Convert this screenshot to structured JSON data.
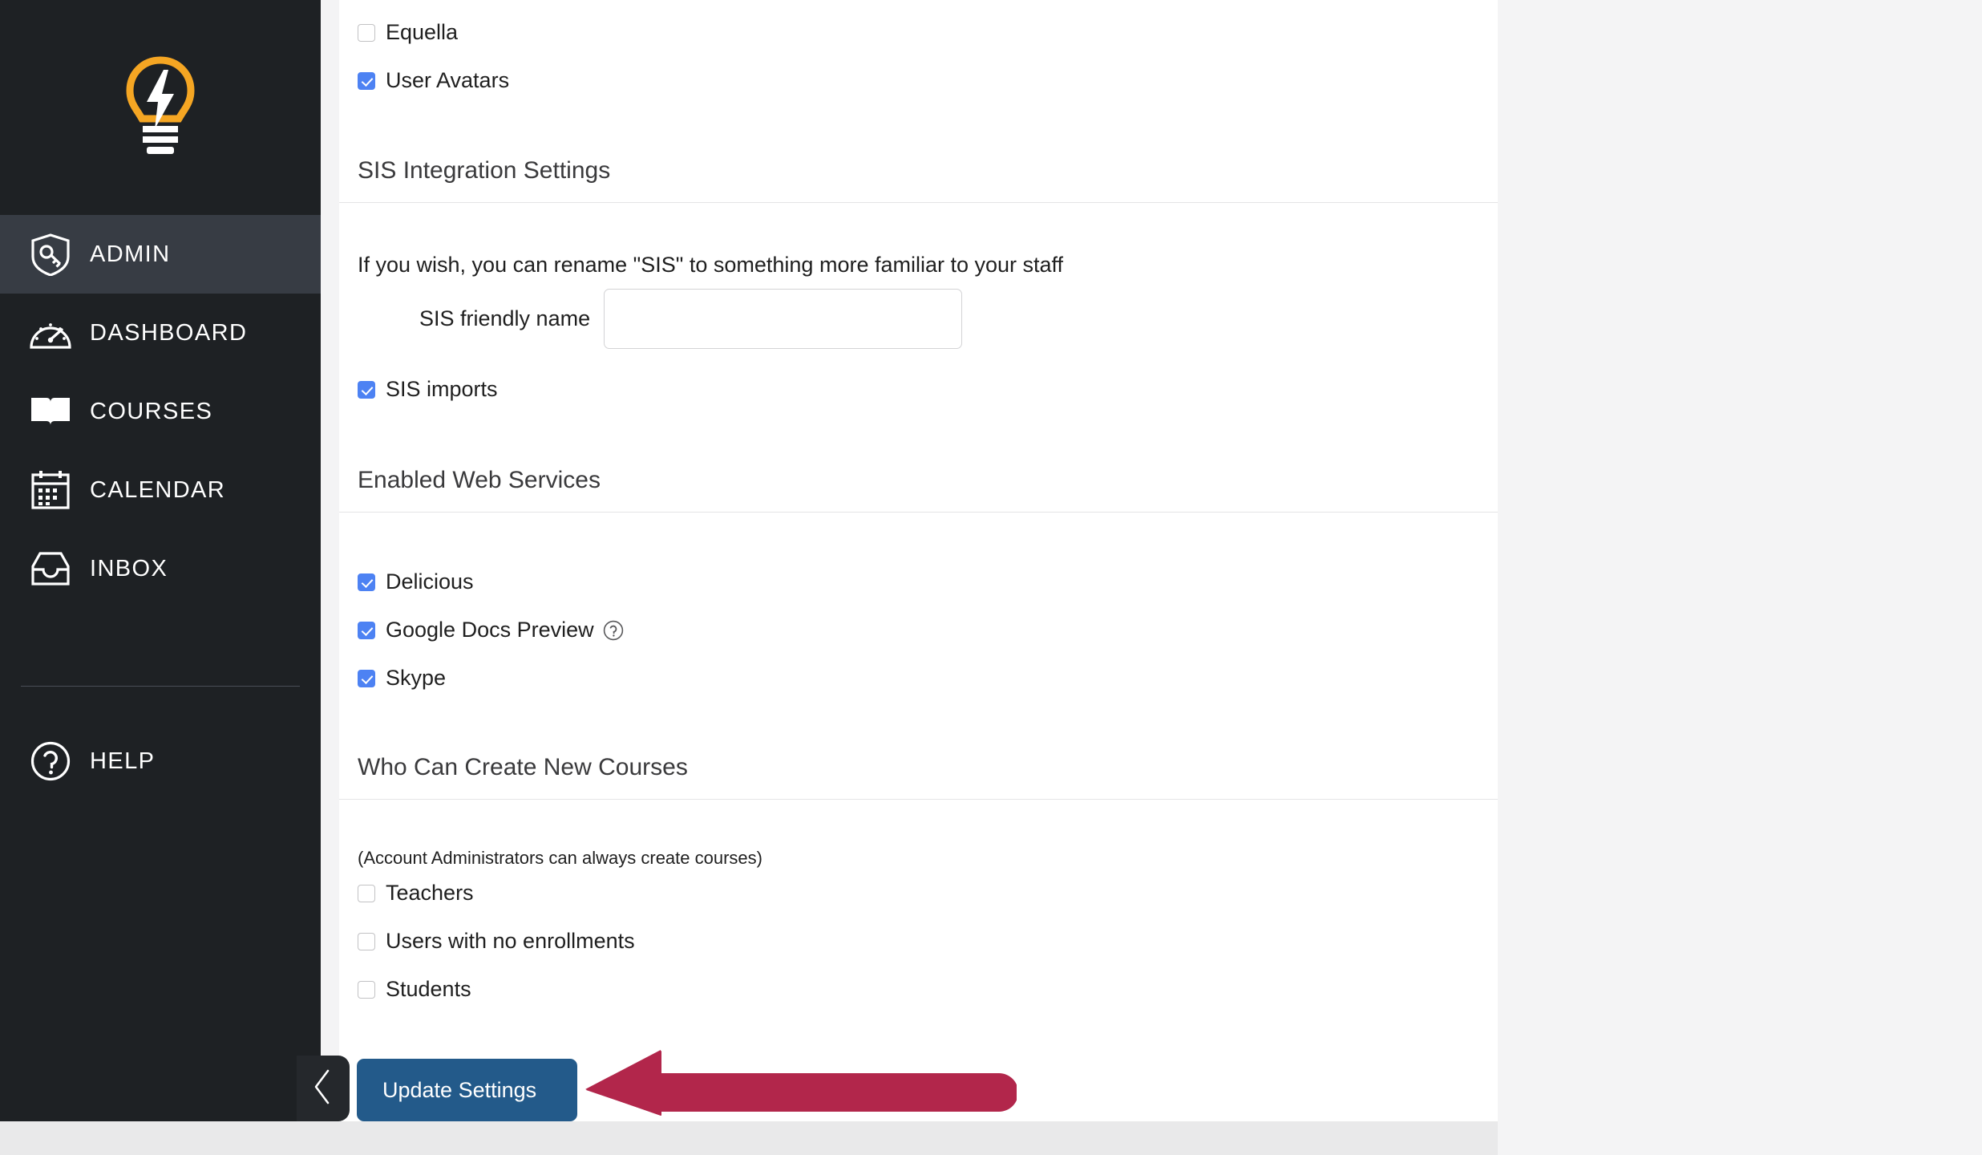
{
  "sidebar": {
    "logo": {
      "name": "lightbulb-logo",
      "bulb_color": "#F5A623",
      "bolt_color": "#FFFFFF"
    },
    "items": [
      {
        "label": "ADMIN",
        "icon": "shield-key-icon",
        "active": true
      },
      {
        "label": "DASHBOARD",
        "icon": "gauge-icon",
        "active": false
      },
      {
        "label": "COURSES",
        "icon": "open-book-icon",
        "active": false
      },
      {
        "label": "CALENDAR",
        "icon": "calendar-icon",
        "active": false
      },
      {
        "label": "INBOX",
        "icon": "inbox-tray-icon",
        "active": false
      }
    ],
    "help": {
      "label": "HELP",
      "icon": "question-circle-icon"
    },
    "active_bg": "#373C44",
    "bg": "#1E2124"
  },
  "main": {
    "top_checkboxes": [
      {
        "label": "Equella",
        "checked": false
      },
      {
        "label": "User Avatars",
        "checked": true
      }
    ],
    "sis_section": {
      "heading": "SIS Integration Settings",
      "description": "If you wish, you can rename \"SIS\" to something more familiar to your staff",
      "field_label": "SIS friendly name",
      "field_value": "",
      "field_placeholder": "",
      "checkbox": {
        "label": "SIS imports",
        "checked": true
      }
    },
    "web_services_section": {
      "heading": "Enabled Web Services",
      "items": [
        {
          "label": "Delicious",
          "checked": true,
          "help": false
        },
        {
          "label": "Google Docs Preview",
          "checked": true,
          "help": true
        },
        {
          "label": "Skype",
          "checked": true,
          "help": false
        }
      ]
    },
    "courses_section": {
      "heading": "Who Can Create New Courses",
      "note": "(Account Administrators can always create courses)",
      "items": [
        {
          "label": "Teachers",
          "checked": false
        },
        {
          "label": "Users with no enrollments",
          "checked": false
        },
        {
          "label": "Students",
          "checked": false
        }
      ]
    },
    "update_button": {
      "label": "Update Settings",
      "color": "#235A8A"
    },
    "collapse_tab": {
      "icon": "chevron-left-icon"
    }
  },
  "annotation": {
    "arrow": {
      "name": "red-arrow-pointing-left",
      "color": "#B2264B",
      "direction": "left"
    }
  },
  "colors": {
    "checkbox_checked": "#4D82F3",
    "page_gray": "#F4F4F5",
    "footer_gray": "#E9E9EA",
    "divider": "#E4E4E6"
  }
}
